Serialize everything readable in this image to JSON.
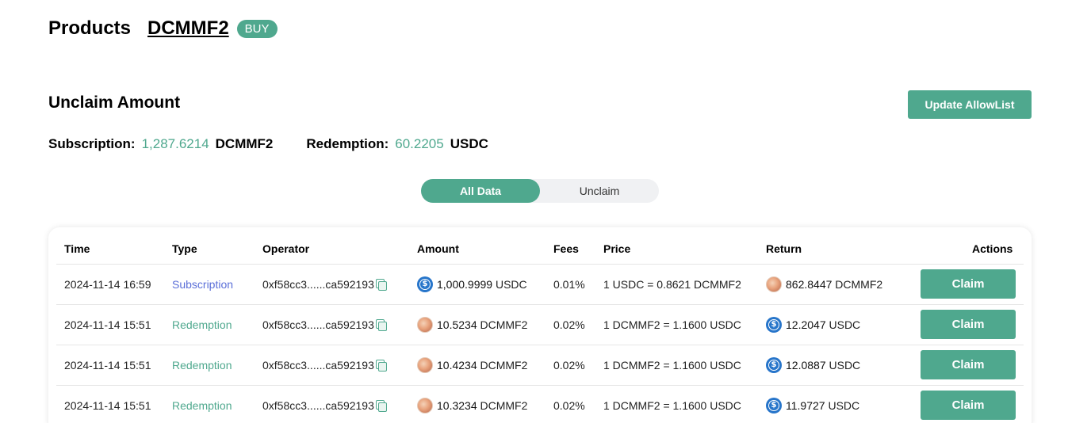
{
  "header": {
    "title": "Products",
    "product": "DCMMF2",
    "badge": "BUY"
  },
  "unclaim": {
    "title": "Unclaim Amount",
    "update_button": "Update AllowList",
    "subscription_label": "Subscription:",
    "subscription_value": "1,287.6214",
    "subscription_unit": "DCMMF2",
    "redemption_label": "Redemption:",
    "redemption_value": "60.2205",
    "redemption_unit": "USDC"
  },
  "tabs": [
    {
      "label": "All Data",
      "active": true
    },
    {
      "label": "Unclaim",
      "active": false
    }
  ],
  "table": {
    "columns": [
      "Time",
      "Type",
      "Operator",
      "Amount",
      "Fees",
      "Price",
      "Return",
      "Actions"
    ],
    "rows": [
      {
        "time": "2024-11-14 16:59",
        "type": "Subscription",
        "operator": "0xf58cc3......ca592193",
        "amount_icon": "usdc-icon",
        "amount": "1,000.9999",
        "amount_unit": "USDC",
        "fees": "0.01%",
        "price": "1 USDC = 0.8621 DCMMF2",
        "return_icon": "dcmmf2-icon",
        "return": "862.8447",
        "return_unit": "DCMMF2",
        "action": "Claim"
      },
      {
        "time": "2024-11-14 15:51",
        "type": "Redemption",
        "operator": "0xf58cc3......ca592193",
        "amount_icon": "dcmmf2-icon",
        "amount": "10.5234",
        "amount_unit": "DCMMF2",
        "fees": "0.02%",
        "price": "1 DCMMF2 = 1.1600 USDC",
        "return_icon": "usdc-icon",
        "return": "12.2047",
        "return_unit": "USDC",
        "action": "Claim"
      },
      {
        "time": "2024-11-14 15:51",
        "type": "Redemption",
        "operator": "0xf58cc3......ca592193",
        "amount_icon": "dcmmf2-icon",
        "amount": "10.4234",
        "amount_unit": "DCMMF2",
        "fees": "0.02%",
        "price": "1 DCMMF2 = 1.1600 USDC",
        "return_icon": "usdc-icon",
        "return": "12.0887",
        "return_unit": "USDC",
        "action": "Claim"
      },
      {
        "time": "2024-11-14 15:51",
        "type": "Redemption",
        "operator": "0xf58cc3......ca592193",
        "amount_icon": "dcmmf2-icon",
        "amount": "10.3234",
        "amount_unit": "DCMMF2",
        "fees": "0.02%",
        "price": "1 DCMMF2 = 1.1600 USDC",
        "return_icon": "usdc-icon",
        "return": "11.9727",
        "return_unit": "USDC",
        "action": "Claim"
      }
    ]
  },
  "colors": {
    "accent": "#4fa88e",
    "subscription_type": "#5b6fd8",
    "usdc_coin": "#2775ca"
  }
}
